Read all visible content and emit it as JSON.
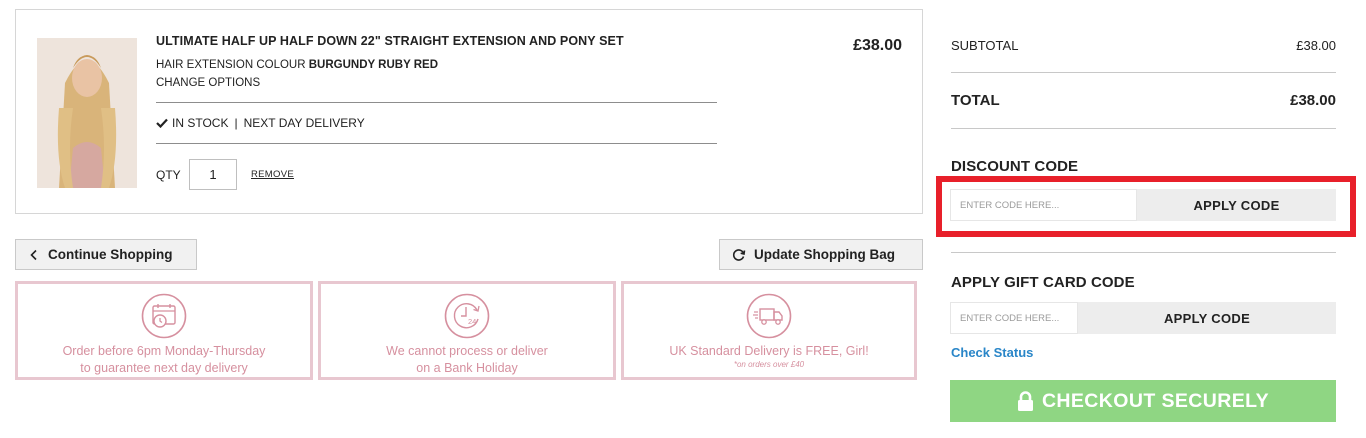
{
  "cart_item": {
    "title": "ULTIMATE HALF UP HALF DOWN 22\" STRAIGHT EXTENSION AND PONY SET",
    "colour_label": "HAIR EXTENSION COLOUR",
    "colour_value": "BURGUNDY RUBY RED",
    "change_options": "CHANGE OPTIONS",
    "stock_status": "IN STOCK",
    "separator": "|",
    "delivery": "NEXT DAY DELIVERY",
    "qty_label": "QTY",
    "qty_value": "1",
    "remove_label": "REMOVE",
    "price": "£38.00",
    "image_icon": "product-photo"
  },
  "actions": {
    "continue_label": "Continue Shopping",
    "update_label": "Update Shopping Bag"
  },
  "info_boxes": [
    {
      "icon": "calendar-clock-icon",
      "line1": "Order before 6pm Monday-Thursday",
      "line2": "to guarantee next day delivery"
    },
    {
      "icon": "clock-24-icon",
      "line1": "We cannot process or deliver",
      "line2": "on a Bank Holiday"
    },
    {
      "icon": "delivery-truck-icon",
      "line1": "UK Standard Delivery is FREE, Girl!",
      "note": "*on orders over £40"
    }
  ],
  "summary": {
    "subtotal_label": "SUBTOTAL",
    "subtotal_value": "£38.00",
    "total_label": "TOTAL",
    "total_value": "£38.00"
  },
  "discount": {
    "heading": "DISCOUNT CODE",
    "placeholder": "ENTER CODE HERE...",
    "button": "APPLY CODE"
  },
  "gift_card": {
    "heading": "APPLY GIFT CARD CODE",
    "placeholder": "ENTER CODE HERE...",
    "button": "APPLY CODE",
    "check_status": "Check Status"
  },
  "checkout": {
    "label": "CHECKOUT SECURELY"
  },
  "colors": {
    "highlight_red": "#e8202a",
    "checkout_green": "#8fd683",
    "link_blue": "#2a86c8",
    "info_pink": "#d6909f",
    "info_border": "#e8c7d0"
  }
}
